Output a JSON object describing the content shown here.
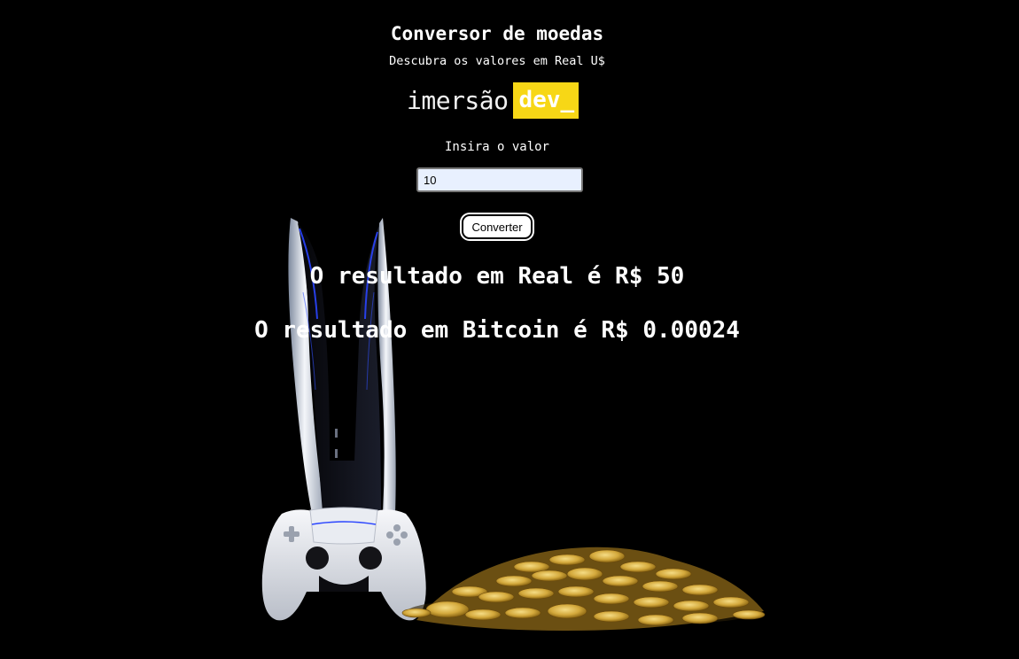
{
  "header": {
    "title": "Conversor de moedas",
    "subtitle": "Descubra os valores em Real U$"
  },
  "logo": {
    "text": "imersão",
    "badge": "dev_",
    "badge_color": "#f7d716"
  },
  "form": {
    "label": "Insira o valor",
    "input_value": "10",
    "button_label": "Converter"
  },
  "results": {
    "real": "O resultado em Real é R$ 50",
    "bitcoin": "O resultado em Bitcoin é R$ 0.00024"
  },
  "background": {
    "illustration": "game-console-controller-gold-coins"
  }
}
